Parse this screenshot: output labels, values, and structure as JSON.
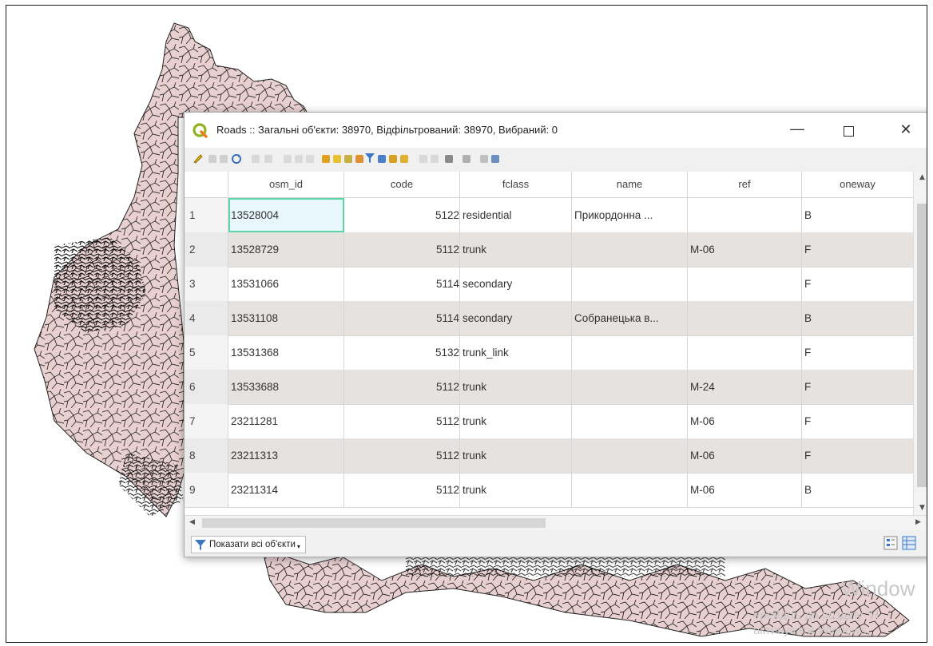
{
  "window": {
    "title": "Roads :: Загальні об'єкти: 38970, Відфільтрований: 38970, Вибраний: 0",
    "minimize_glyph": "—",
    "close_glyph": "✕"
  },
  "table": {
    "columns": [
      "osm_id",
      "code",
      "fclass",
      "name",
      "ref",
      "oneway"
    ],
    "rows": [
      {
        "n": "1",
        "osm_id": "13528004",
        "code": "5122",
        "fclass": "residential",
        "name": "Прикордонна ...",
        "ref": "",
        "oneway": "B"
      },
      {
        "n": "2",
        "osm_id": "13528729",
        "code": "5112",
        "fclass": "trunk",
        "name": "",
        "ref": "M-06",
        "oneway": "F"
      },
      {
        "n": "3",
        "osm_id": "13531066",
        "code": "5114",
        "fclass": "secondary",
        "name": "",
        "ref": "",
        "oneway": "F"
      },
      {
        "n": "4",
        "osm_id": "13531108",
        "code": "5114",
        "fclass": "secondary",
        "name": "Собранецька в...",
        "ref": "",
        "oneway": "B"
      },
      {
        "n": "5",
        "osm_id": "13531368",
        "code": "5132",
        "fclass": "trunk_link",
        "name": "",
        "ref": "",
        "oneway": "F"
      },
      {
        "n": "6",
        "osm_id": "13533688",
        "code": "5112",
        "fclass": "trunk",
        "name": "",
        "ref": "M-24",
        "oneway": "F"
      },
      {
        "n": "7",
        "osm_id": "23211281",
        "code": "5112",
        "fclass": "trunk",
        "name": "",
        "ref": "M-06",
        "oneway": "F"
      },
      {
        "n": "8",
        "osm_id": "23211313",
        "code": "5112",
        "fclass": "trunk",
        "name": "",
        "ref": "M-06",
        "oneway": "F"
      },
      {
        "n": "9",
        "osm_id": "23211314",
        "code": "5112",
        "fclass": "trunk",
        "name": "",
        "ref": "M-06",
        "oneway": "B"
      }
    ]
  },
  "bottom": {
    "filter_label": "Показати всі об'єкти"
  },
  "watermark": {
    "line1": "Window",
    "line2": "ерейдіть до розділу \"Н",
    "line3": "активувати Windows."
  },
  "colors": {
    "map_fill": "#e8cfd0",
    "selection_border": "#5cd6a8",
    "alt_row": "#e5e2df"
  }
}
